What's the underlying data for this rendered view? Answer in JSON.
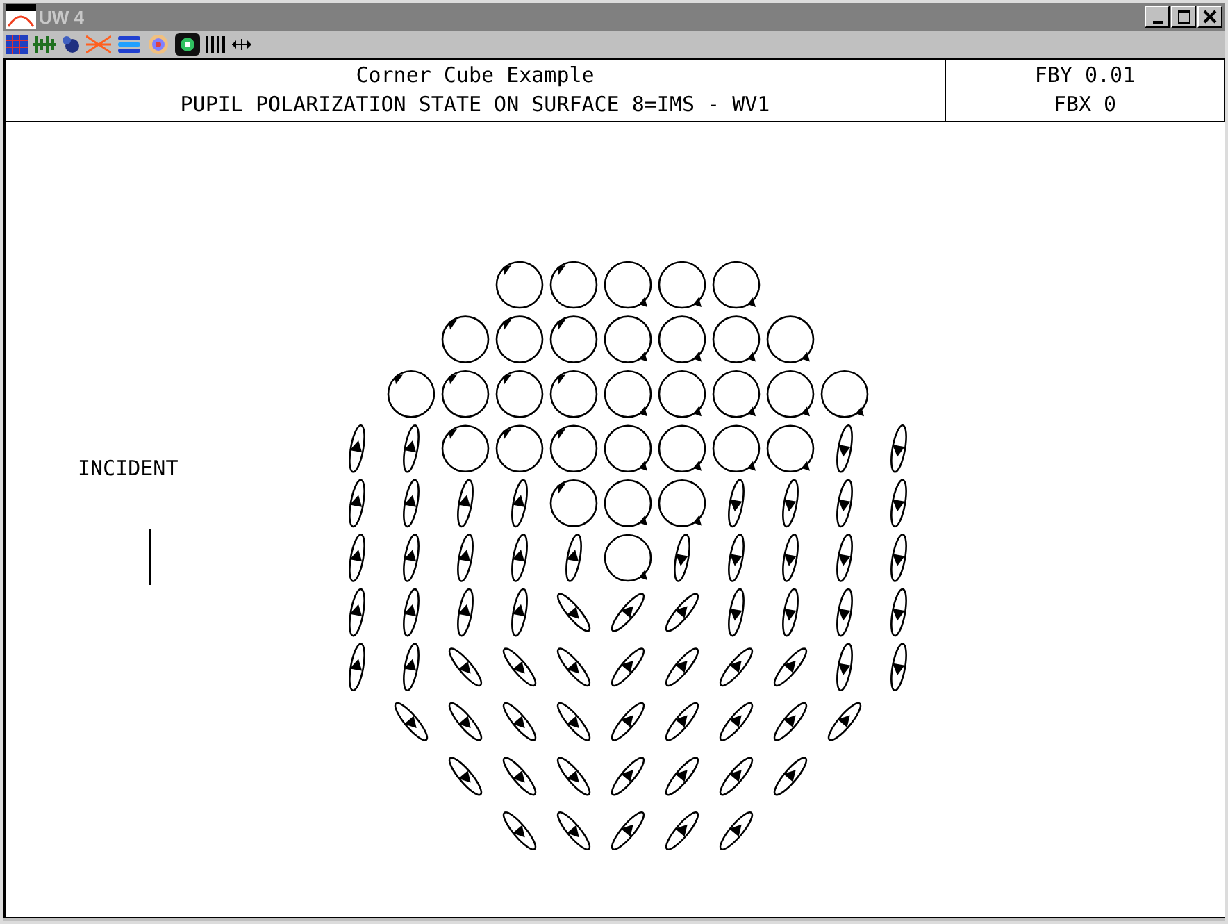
{
  "window": {
    "title": "UW 4"
  },
  "header": {
    "title": "Corner Cube Example",
    "subtitle": "PUPIL POLARIZATION STATE ON SURFACE 8=IMS - WV1",
    "field_y": "FBY 0.01",
    "field_x": "FBX 0"
  },
  "plot": {
    "label": "INCIDENT"
  }
}
